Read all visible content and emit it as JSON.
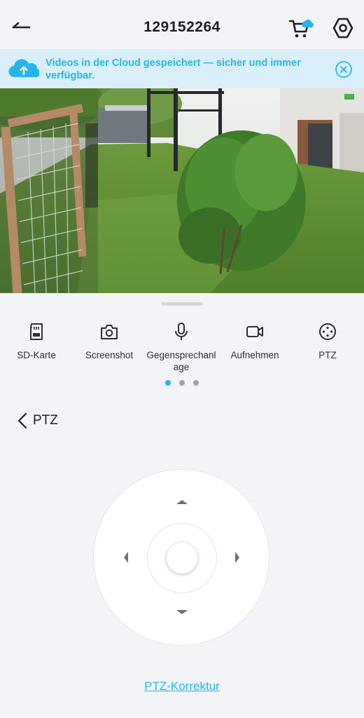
{
  "header": {
    "title": "129152264"
  },
  "banner": {
    "text": "Videos in der Cloud gespeichert — sicher und immer verfügbar."
  },
  "toolbar": {
    "items": [
      {
        "label": "SD-Karte",
        "icon": "sd-card-icon"
      },
      {
        "label": "Screenshot",
        "icon": "camera-icon"
      },
      {
        "label": "Gegensprechanl\nage",
        "icon": "microphone-icon"
      },
      {
        "label": "Aufnehmen",
        "icon": "video-record-icon"
      },
      {
        "label": "PTZ",
        "icon": "ptz-icon"
      }
    ],
    "page_dots": {
      "count": 3,
      "active": 0
    }
  },
  "ptz": {
    "back_label": "PTZ",
    "correction_link": "PTZ-Korrektur"
  },
  "colors": {
    "accent": "#27b4ea",
    "banner_bg": "#d9f0fa",
    "background": "#f2f4f8",
    "dot_inactive": "#9ea2a9"
  }
}
